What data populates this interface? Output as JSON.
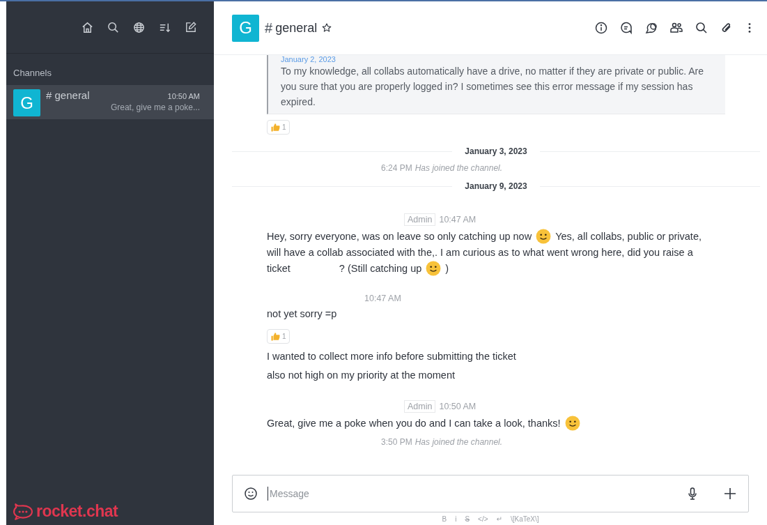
{
  "sidebar": {
    "section_title": "Channels",
    "rooms": [
      {
        "avatar": "G",
        "symbol": "#",
        "name": "general",
        "time": "10:50 AM",
        "preview": "Great, give me a poke...",
        "selected": true
      }
    ],
    "brand": "rocket.chat"
  },
  "header": {
    "avatar": "G",
    "symbol": "#",
    "title": "general",
    "favorite": false
  },
  "messages": [
    {
      "kind": "quote",
      "date": "January 2, 2023",
      "text": "To my knowledge, all collabs automatically have a drive, no matter if they are private or public. Are you sure that you are properly logged in? I sometimes see this error message if my session has expired."
    },
    {
      "kind": "reaction",
      "count": "1"
    },
    {
      "kind": "date",
      "text": "January 3, 2023"
    },
    {
      "kind": "system",
      "time": "6:24 PM",
      "text": "Has joined the channel."
    },
    {
      "kind": "date",
      "text": "January 9, 2023"
    },
    {
      "kind": "header",
      "role": "Admin",
      "time": "10:47 AM"
    },
    {
      "kind": "text",
      "parts": [
        {
          "kind": "text",
          "text": "Hey, sorry everyone, was on leave so only catching up now"
        },
        {
          "kind": "emoji"
        },
        {
          "kind": "text",
          "text": "Yes, all collabs, public or private,"
        },
        {
          "kind": "break"
        },
        {
          "kind": "text",
          "text": "will have a collab associated with the,. I am curious as to what went wrong here, did you raise a"
        },
        {
          "kind": "break"
        },
        {
          "kind": "text",
          "text": "ticket"
        },
        {
          "kind": "blank"
        },
        {
          "kind": "text",
          "text": "? (Still catching up"
        },
        {
          "kind": "emoji"
        },
        {
          "kind": "text",
          "text": ")"
        }
      ]
    },
    {
      "kind": "header",
      "time": "10:47 AM"
    },
    {
      "kind": "text",
      "parts": [
        {
          "kind": "text",
          "text": "not yet sorry =p"
        }
      ]
    },
    {
      "kind": "reaction",
      "count": "1"
    },
    {
      "kind": "text",
      "parts": [
        {
          "kind": "text",
          "text": "I wanted to collect more info before submitting the ticket"
        }
      ]
    },
    {
      "kind": "text",
      "parts": [
        {
          "kind": "text",
          "text": "also not high on my priority at the moment"
        }
      ]
    },
    {
      "kind": "header",
      "role": "Admin",
      "time": "10:50 AM"
    },
    {
      "kind": "text",
      "parts": [
        {
          "kind": "text",
          "text": "Great, give me a poke when you do and I can take a look, thanks!"
        },
        {
          "kind": "emoji"
        }
      ]
    },
    {
      "kind": "system",
      "time": "3:50 PM",
      "text": "Has joined the channel."
    }
  ],
  "composer": {
    "placeholder": "Message"
  },
  "format_bar": [
    "B",
    "i",
    "S",
    "</>",
    "↵",
    "\\[KaTeX\\]"
  ]
}
